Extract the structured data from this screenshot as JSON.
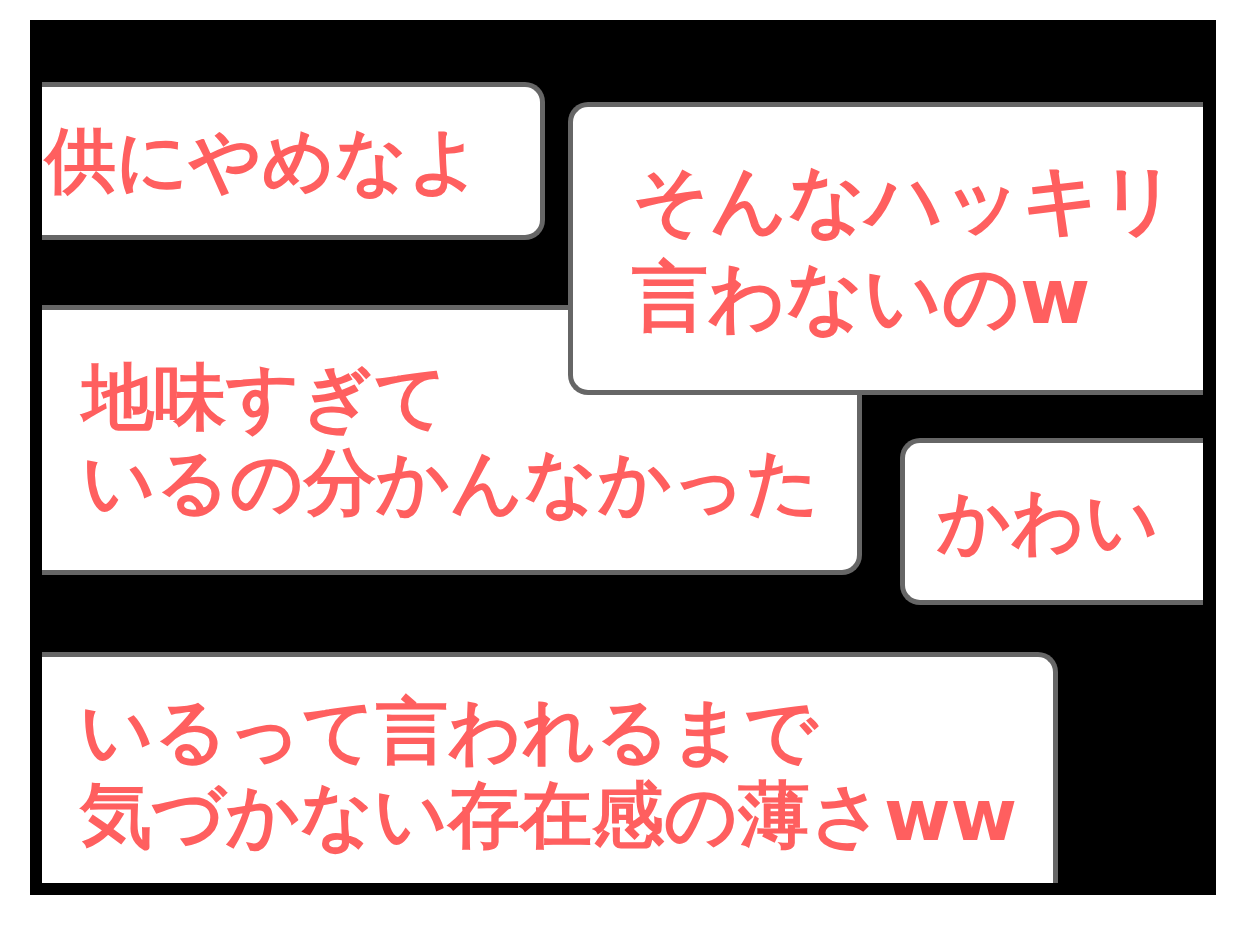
{
  "comments": [
    {
      "lines": [
        "供にやめなよ"
      ]
    },
    {
      "lines": [
        "そんなハッキリ",
        "言わないのw"
      ]
    },
    {
      "lines": [
        "地味すぎて",
        "いるの分かんなかった"
      ]
    },
    {
      "lines": [
        "かわい"
      ]
    },
    {
      "lines": [
        "いるって言われるまで",
        "気づかない存在感の薄さww"
      ]
    }
  ]
}
